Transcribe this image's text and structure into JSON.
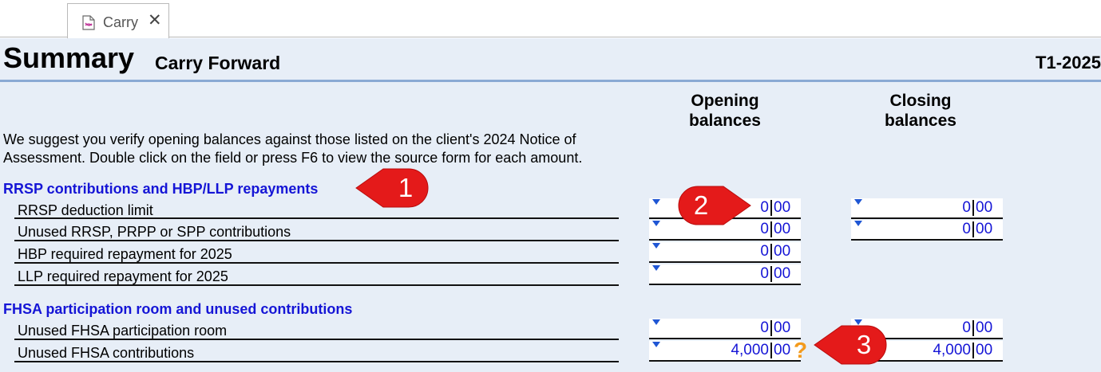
{
  "tab": {
    "label": "Carry",
    "close_glyph": "✕"
  },
  "header": {
    "title": "Summary",
    "subtitle": "Carry Forward",
    "form_id": "T1-2025"
  },
  "columns": {
    "opening": [
      "Opening",
      "balances"
    ],
    "closing": [
      "Closing",
      "balances"
    ]
  },
  "intro": "We suggest you verify opening balances against those listed on the client's 2024 Notice of Assessment. Double click on the field or press F6 to view the source form for each amount.",
  "sections": [
    {
      "heading": "RRSP contributions and HBP/LLP repayments",
      "rows": [
        {
          "label": "RRSP deduction limit",
          "opening": {
            "dollars": "0",
            "cents": "00"
          },
          "closing": {
            "dollars": "0",
            "cents": "00"
          }
        },
        {
          "label": "Unused RRSP, PRPP or SPP contributions",
          "opening": {
            "dollars": "0",
            "cents": "00"
          },
          "closing": {
            "dollars": "0",
            "cents": "00"
          }
        },
        {
          "label": "HBP required repayment for 2025",
          "opening": {
            "dollars": "0",
            "cents": "00"
          }
        },
        {
          "label": "LLP required repayment for 2025",
          "opening": {
            "dollars": "0",
            "cents": "00"
          }
        }
      ]
    },
    {
      "heading": "FHSA participation room and unused contributions",
      "rows": [
        {
          "label": "Unused FHSA participation room",
          "opening": {
            "dollars": "0",
            "cents": "00"
          },
          "closing": {
            "dollars": "0",
            "cents": "00"
          }
        },
        {
          "label": "Unused FHSA contributions",
          "opening": {
            "dollars": "4,000",
            "cents": "00"
          },
          "closing": {
            "dollars": "4,000",
            "cents": "00"
          }
        }
      ]
    }
  ],
  "review_marker": "?",
  "callouts": [
    "1",
    "2",
    "3"
  ],
  "colors": {
    "section_heading": "#1515d6",
    "amount_text": "#1515d6",
    "form_background": "#e7eef7",
    "title_rule": "#8aaad4",
    "callout_fill": "#e41a1a",
    "review_marker": "#f39a1c"
  },
  "icons": {
    "tab": "form-document-icon",
    "field_marker": "dropdown-triangle-icon"
  }
}
